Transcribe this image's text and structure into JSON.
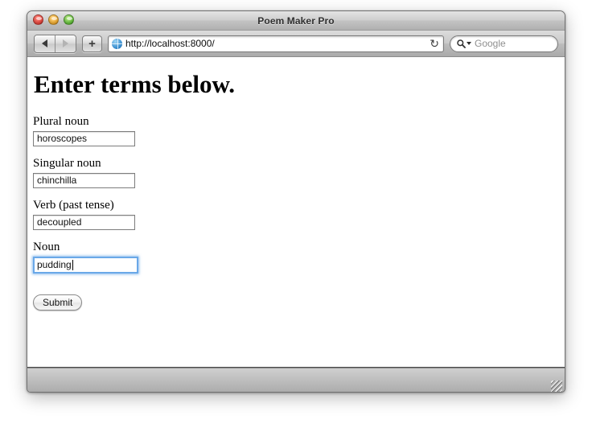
{
  "window": {
    "title": "Poem Maker Pro",
    "controls": {
      "close": "close-button",
      "minimize": "minimize-button",
      "maximize": "maximize-button"
    }
  },
  "toolbar": {
    "back_label": "◀",
    "forward_label": "▶",
    "add_label": "+",
    "url": "http://localhost:8000/",
    "reload_label": "↻",
    "search_placeholder": "Google"
  },
  "page": {
    "heading": "Enter terms below.",
    "fields": [
      {
        "label": "Plural noun",
        "value": "horoscopes",
        "focused": false
      },
      {
        "label": "Singular noun",
        "value": "chinchilla",
        "focused": false
      },
      {
        "label": "Verb (past tense)",
        "value": "decoupled",
        "focused": false
      },
      {
        "label": "Noun",
        "value": "pudding",
        "focused": true
      }
    ],
    "submit_label": "Submit"
  },
  "colors": {
    "focus_ring": "#6aa8e8",
    "titlebar_text": "#303030",
    "page_background": "#ffffff"
  }
}
